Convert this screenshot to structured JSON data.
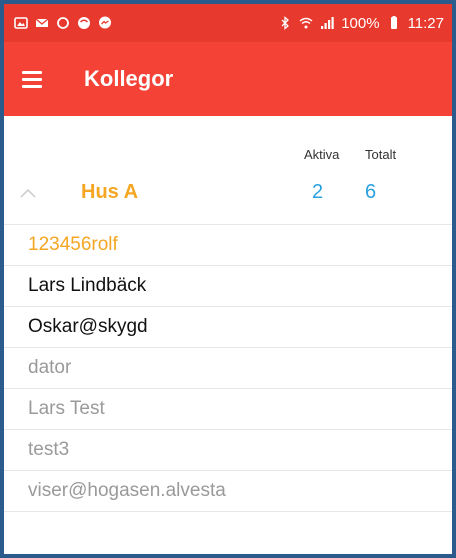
{
  "statusbar": {
    "battery": "100%",
    "time": "11:27"
  },
  "appbar": {
    "title": "Kollegor"
  },
  "columns": {
    "aktiva": "Aktiva",
    "totalt": "Totalt"
  },
  "group": {
    "name": "Hus A",
    "aktiva": "2",
    "totalt": "6"
  },
  "members": [
    {
      "name": "123456rolf",
      "status": "orange"
    },
    {
      "name": "Lars Lindbäck",
      "status": "black"
    },
    {
      "name": "Oskar@skygd",
      "status": "black"
    },
    {
      "name": "dator",
      "status": "gray"
    },
    {
      "name": "Lars Test",
      "status": "gray"
    },
    {
      "name": "test3",
      "status": "gray"
    },
    {
      "name": "viser@hogasen.alvesta",
      "status": "gray"
    }
  ],
  "colors": {
    "statusbar": "#e8392e",
    "appbar": "#f44336",
    "accent_orange": "#f5a623",
    "accent_blue": "#2aa1e0",
    "frame": "#2b5a8c"
  }
}
